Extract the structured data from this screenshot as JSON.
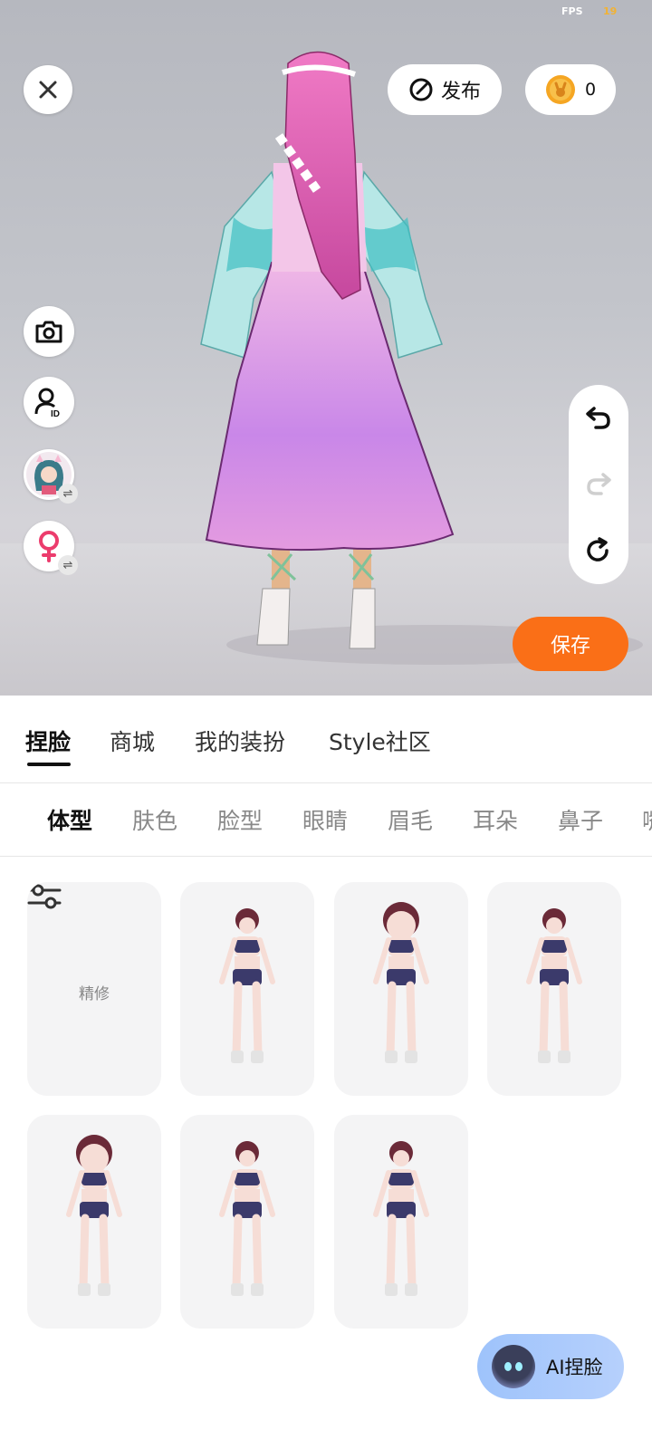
{
  "status": {
    "fps_label": "FPS",
    "fps_value": "19"
  },
  "top": {
    "close_icon": "close-icon",
    "publish_label": "发布",
    "coin_count": "0"
  },
  "side_tools": [
    "camera-icon",
    "user-id-icon",
    "avatar-swap",
    "gender-female-swap-icon"
  ],
  "edit_tools": [
    "undo-icon",
    "redo-icon",
    "reset-icon"
  ],
  "save_label": "保存",
  "main_tabs": [
    {
      "label": "捏脸",
      "active": true
    },
    {
      "label": "商城"
    },
    {
      "label": "我的装扮"
    },
    {
      "label": "Style社区"
    }
  ],
  "sub_tabs": [
    {
      "label": "体型",
      "active": true
    },
    {
      "label": "肤色"
    },
    {
      "label": "脸型"
    },
    {
      "label": "眼睛"
    },
    {
      "label": "眉毛"
    },
    {
      "label": "耳朵"
    },
    {
      "label": "鼻子"
    },
    {
      "label": "嘴"
    }
  ],
  "refine_label": "精修",
  "ai_button_label": "AI捏脸",
  "colors": {
    "accent": "#fa6f17",
    "ai_bg": "#a8c8fb",
    "coin": "#f5a623"
  }
}
